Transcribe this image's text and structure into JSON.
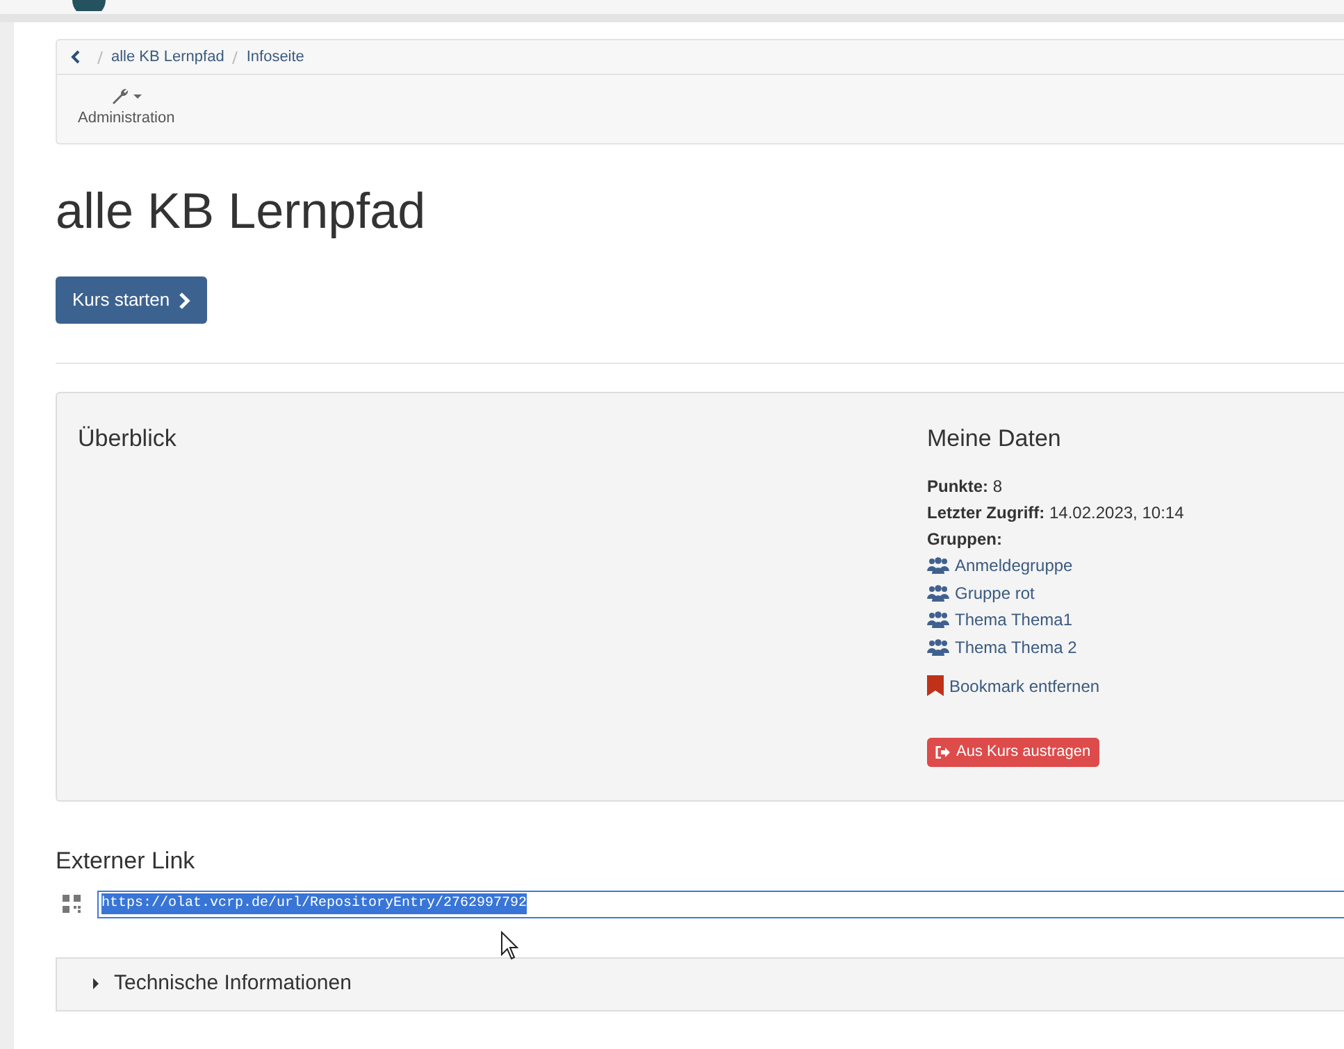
{
  "breadcrumb": {
    "items": [
      {
        "label": "alle KB Lernpfad"
      },
      {
        "label": "Infoseite"
      }
    ]
  },
  "toolbar": {
    "items": [
      {
        "label": "Administration"
      }
    ]
  },
  "title": "alle KB Lernpfad",
  "start_button": {
    "label": "Kurs starten"
  },
  "overview": {
    "heading": "Überblick"
  },
  "my_data": {
    "heading": "Meine Daten",
    "fields": [
      {
        "label": "Punkte:",
        "value": "8"
      },
      {
        "label": "Letzter Zugriff:",
        "value": "14.02.2023, 10:14"
      }
    ],
    "groups_label": "Gruppen:",
    "groups": [
      "Anmeldegruppe",
      "Gruppe rot",
      "Thema Thema1",
      "Thema Thema 2"
    ],
    "bookmark_link": "Bookmark entfernen",
    "leave_button": "Aus Kurs austragen"
  },
  "external_link": {
    "label": "Externer Link",
    "value": "https://olat.vcrp.de/url/RepositoryEntry/2762997792",
    "text_selected": true
  },
  "technical_info": {
    "label": "Technische Informationen",
    "expanded": false
  }
}
